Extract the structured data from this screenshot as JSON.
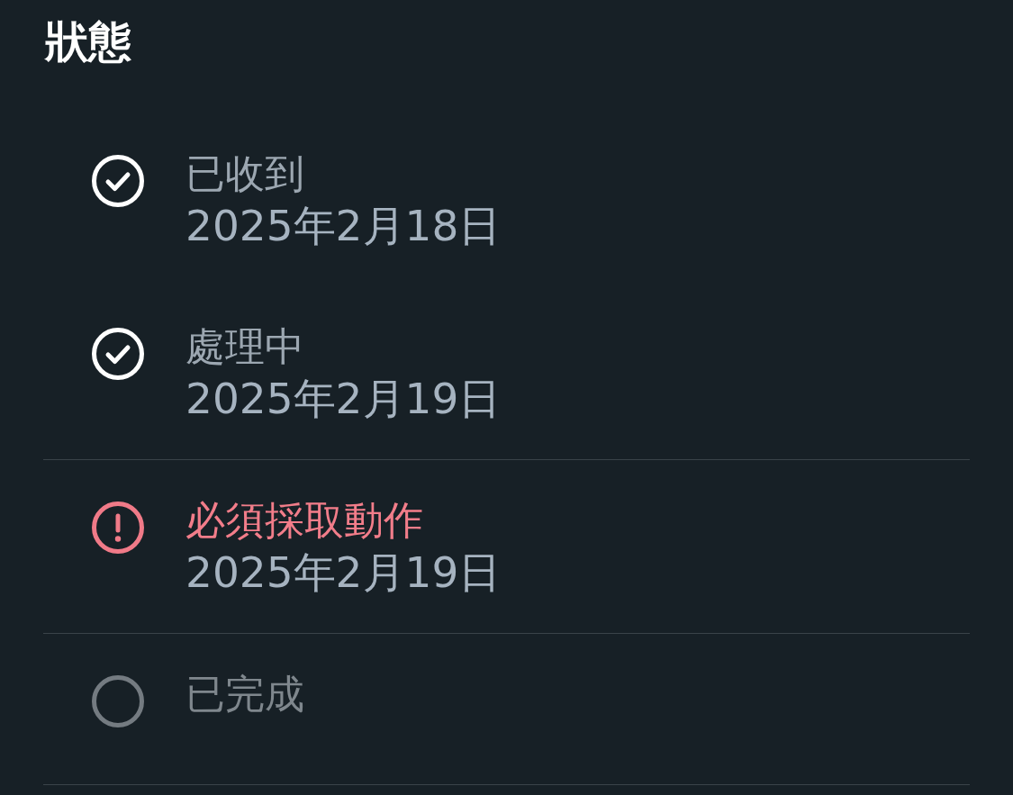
{
  "title": "狀態",
  "steps": [
    {
      "kind": "done",
      "label": "已收到",
      "date": "2025年2月18日"
    },
    {
      "kind": "done",
      "label": "處理中",
      "date": "2025年2月19日"
    },
    {
      "kind": "alert",
      "label": "必須採取動作",
      "date": "2025年2月19日"
    },
    {
      "kind": "pending",
      "label": "已完成"
    }
  ]
}
